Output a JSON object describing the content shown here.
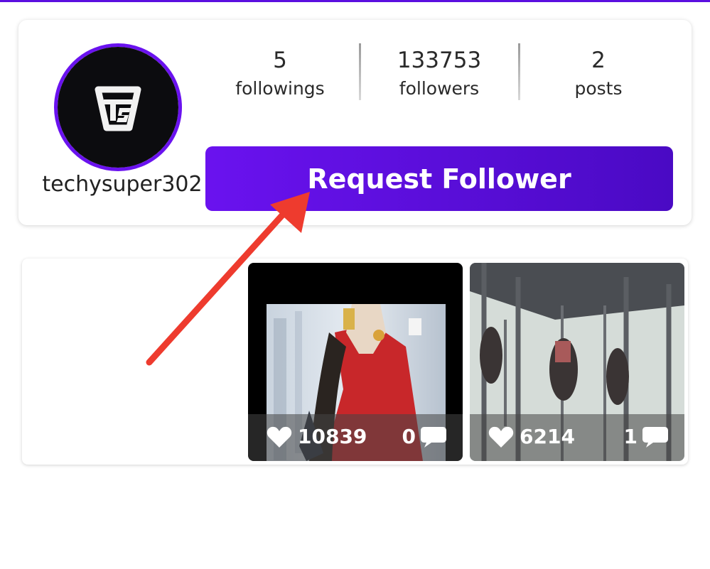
{
  "colors": {
    "accent": "#5b0fe0",
    "accent_light": "#6a12ef",
    "accent_dark": "#4a0ac4",
    "arrow": "#ee3b2e"
  },
  "profile": {
    "username": "techysuper302",
    "avatar_icon": "ts-logo-icon",
    "stats": [
      {
        "value": "5",
        "label": "followings"
      },
      {
        "value": "133753",
        "label": "followers"
      },
      {
        "value": "2",
        "label": "posts"
      }
    ],
    "request_button_label": "Request Follower"
  },
  "posts": [
    {
      "likes": "10839",
      "comments": "0",
      "like_icon": "heart-icon",
      "comment_icon": "speech-bubble-icon"
    },
    {
      "likes": "6214",
      "comments": "1",
      "like_icon": "heart-icon",
      "comment_icon": "speech-bubble-icon"
    }
  ],
  "annotation": {
    "icon": "red-arrow-icon"
  }
}
